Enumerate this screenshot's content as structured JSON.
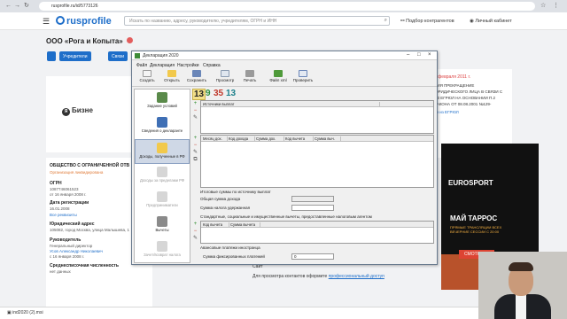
{
  "browser": {
    "url": "rusprofile.ru/id/5773126",
    "back_icon": "arrow-left-icon",
    "reload_icon": "reload-icon",
    "menu_icon": "more-vert-icon"
  },
  "site": {
    "logo": "rusprofile",
    "search_placeholder": "Искать по названию, адресу, руководителю, учредителям, ОГРН и ИНН",
    "nav_select": "Подбор контрагентов",
    "nav_cabinet": "Личный кабинет"
  },
  "company": {
    "title": "ООО «Рога и Копыта»",
    "btn_founders": "Учредители",
    "btn_links": "Связи",
    "full_name": "ОБЩЕСТВО С ОГРАНИЧЕННОЙ ОТВ",
    "status": "Организация ликвидирована",
    "ogrn_label": "ОГРН",
    "ogrn_value": "1087746061523",
    "ogrn_date": "от 16 января 2008 г.",
    "reg_date_label": "Дата регистрации",
    "reg_date_value": "16.01.2008",
    "requisites_link": "Все реквизиты",
    "address_label": "Юридический адрес",
    "address_value": "105082, город Москва, улица Малышева, 1",
    "head_label": "Руководитель",
    "head_role": "Генеральный директор",
    "head_name": "Усов Александр Николаевич",
    "head_since": "с 16 января 2008 г.",
    "employees_label": "Среднесписочная численность",
    "employees_value": "нет данных",
    "banner_text": "Бизне"
  },
  "right_panel": {
    "date": "1 февраля 2011 г.",
    "lines": [
      "ЦИЯ ПРЕКРАЩЕНИЕ",
      "ЮРИДИЧЕСКОГО ЛИЦА В СВЯЗИ С",
      "ИЗ ЕГРЮЛ НА ОСНОВАНИИ П.2",
      "ЗАКОНА ОТ 08.08.2001 №129-"
    ],
    "link": "ия из ЕГРЮЛ",
    "site_label": "Сайт",
    "contacts_note": "Для просмотра контактов оформите",
    "contacts_link": "профессиональный доступ"
  },
  "ad": {
    "brand": "EUROSPORT",
    "headline": "МАЙ ТАРРОС",
    "sub": "ПРЯМЫЕ ТРАНСЛЯЦИИ ВСЕХ ВЕЧЕРНИЕ СЕССИИ С 20:00",
    "cta": "СМОТРЕТЬ"
  },
  "dialog": {
    "title": "Декларация 2020",
    "menu": [
      "Файл",
      "Декларация",
      "Настройки",
      "Справка"
    ],
    "toolbar": [
      "Создать",
      "Открыть",
      "Сохранить",
      "Просмотр",
      "Печать",
      "Файл xml",
      "Проверить"
    ],
    "sidebar": [
      {
        "label": "Задание условий",
        "icon": "settings-tree-icon",
        "active": false,
        "disabled": false
      },
      {
        "label": "Сведения о декларанте",
        "icon": "person-icon",
        "active": false,
        "disabled": false
      },
      {
        "label": "Доходы, полученные в РФ",
        "icon": "folder-icon",
        "active": true,
        "disabled": false
      },
      {
        "label": "Доходы за пределами РФ",
        "icon": "globe-icon",
        "active": false,
        "disabled": true
      },
      {
        "label": "Предприниматели",
        "icon": "briefcase-icon",
        "active": false,
        "disabled": true
      },
      {
        "label": "Вычеты",
        "icon": "calculator-icon",
        "active": false,
        "disabled": false
      },
      {
        "label": "Зачет/возврат налога",
        "icon": "refund-icon",
        "active": false,
        "disabled": true
      }
    ],
    "rate_tabs": [
      "13",
      "9",
      "35",
      "13"
    ],
    "sources_header": "Источники выплат",
    "income_headers": [
      "Месяц дох.",
      "Код дохода",
      "Сумма дох.",
      "Код вычета",
      "Сумма выч."
    ],
    "totals_title": "Итоговые суммы по источнику выплат",
    "total_income_label": "Общая сумма дохода",
    "tax_withheld_label": "Сумма налога удержанная",
    "deductions_title": "Стандартные, социальные и имущественные вычеты, предоставленные налоговым агентом",
    "deduction_headers": [
      "Код вычета",
      "Сумма вычета"
    ],
    "advance_title": "Авансовые платежи иностранца",
    "fixed_payments_label": "Сумма фиксированных платежей",
    "fixed_payments_value": "0"
  },
  "downloads": {
    "file": "ind2020 (2).msi"
  },
  "colors": {
    "accent": "#1e6ec9",
    "liquidated": "#e07b39",
    "date_red": "#dd4444"
  }
}
